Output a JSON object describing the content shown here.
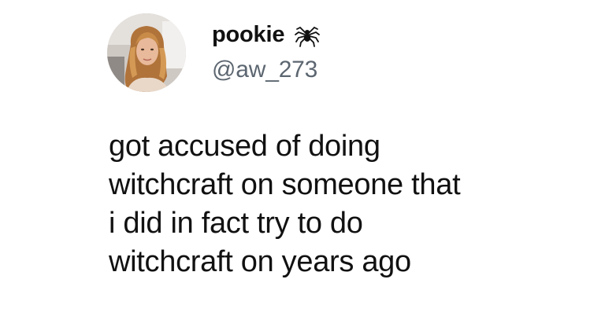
{
  "user": {
    "display_name": "pookie",
    "handle": "@aw_273",
    "badge_icon": "spider-icon",
    "avatar": "profile-photo"
  },
  "tweet": {
    "lines": [
      "got accused of doing",
      "witchcraft on someone that",
      "i did in fact try to do",
      "witchcraft on years ago"
    ]
  },
  "colors": {
    "background": "#ffffff",
    "text": "#111111",
    "handle": "#5c6670"
  }
}
